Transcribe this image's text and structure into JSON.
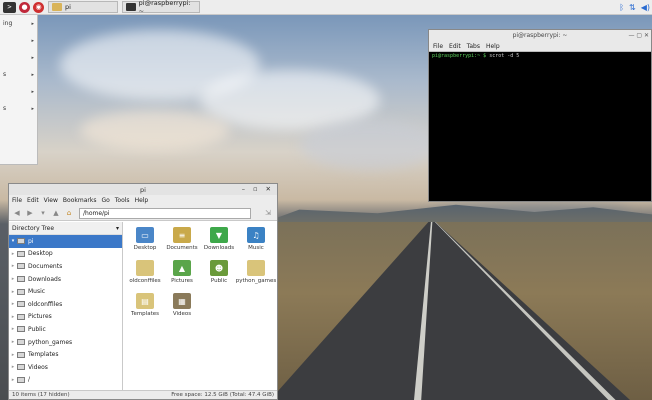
{
  "panel": {
    "tasks": [
      {
        "label": "pi",
        "icon": "folder-icon"
      },
      {
        "label": "pi@raspberrypi: ~",
        "icon": "terminal-icon"
      }
    ],
    "tray": {
      "bluetooth": "ᛒ",
      "network": "⇅",
      "volume": "◀)"
    }
  },
  "app_menu": {
    "items": [
      {
        "label": "ing",
        "arrow": "▸"
      },
      {
        "label": "",
        "arrow": "▸"
      },
      {
        "label": "",
        "arrow": "▸"
      },
      {
        "label": "s",
        "arrow": "▸"
      },
      {
        "label": "",
        "arrow": "▸"
      },
      {
        "label": "s",
        "arrow": "▸"
      },
      {
        "label": "",
        "arrow": ""
      }
    ]
  },
  "terminal": {
    "title": "pi@raspberrypi: ~",
    "menu": [
      "File",
      "Edit",
      "Tabs",
      "Help"
    ],
    "prompt": "pi@raspberrypi:~ $",
    "command": "scrot -d 5"
  },
  "file_manager": {
    "title": "pi",
    "menu": [
      "File",
      "Edit",
      "View",
      "Bookmarks",
      "Go",
      "Tools",
      "Help"
    ],
    "path": "/home/pi",
    "tree_header": "Directory Tree",
    "tree": [
      {
        "label": "pi",
        "selected": true,
        "expander": "▾"
      },
      {
        "label": "Desktop",
        "selected": false,
        "expander": "▸"
      },
      {
        "label": "Documents",
        "selected": false,
        "expander": "▸"
      },
      {
        "label": "Downloads",
        "selected": false,
        "expander": "▸"
      },
      {
        "label": "Music",
        "selected": false,
        "expander": "▸"
      },
      {
        "label": "oldconffiles",
        "selected": false,
        "expander": "▸"
      },
      {
        "label": "Pictures",
        "selected": false,
        "expander": "▸"
      },
      {
        "label": "Public",
        "selected": false,
        "expander": "▸"
      },
      {
        "label": "python_games",
        "selected": false,
        "expander": "▸"
      },
      {
        "label": "Templates",
        "selected": false,
        "expander": "▸"
      },
      {
        "label": "Videos",
        "selected": false,
        "expander": "▸"
      },
      {
        "label": "/",
        "selected": false,
        "expander": "▸"
      }
    ],
    "icons": [
      {
        "label": "Desktop",
        "icon": "desktop-folder-icon",
        "color": "#4a86c8",
        "glyph": "▭"
      },
      {
        "label": "Documents",
        "icon": "documents-folder-icon",
        "color": "#c9a94a",
        "glyph": "≡"
      },
      {
        "label": "Downloads",
        "icon": "downloads-folder-icon",
        "color": "#3ea84a",
        "glyph": "▼"
      },
      {
        "label": "Music",
        "icon": "music-folder-icon",
        "color": "#3b82c4",
        "glyph": "♫"
      },
      {
        "label": "oldconffiles",
        "icon": "folder-icon",
        "color": "#d9c47a",
        "glyph": ""
      },
      {
        "label": "Pictures",
        "icon": "pictures-folder-icon",
        "color": "#5aa54a",
        "glyph": "▲"
      },
      {
        "label": "Public",
        "icon": "public-folder-icon",
        "color": "#6a9a3a",
        "glyph": "☻"
      },
      {
        "label": "python_games",
        "icon": "folder-icon",
        "color": "#d9c47a",
        "glyph": ""
      },
      {
        "label": "Templates",
        "icon": "templates-folder-icon",
        "color": "#d9c47a",
        "glyph": "▤"
      },
      {
        "label": "Videos",
        "icon": "videos-folder-icon",
        "color": "#8a7a5a",
        "glyph": "▦"
      }
    ],
    "status_left": "10 items (17 hidden)",
    "status_right": "Free space: 12.5 GiB (Total: 47.4 GiB)"
  }
}
